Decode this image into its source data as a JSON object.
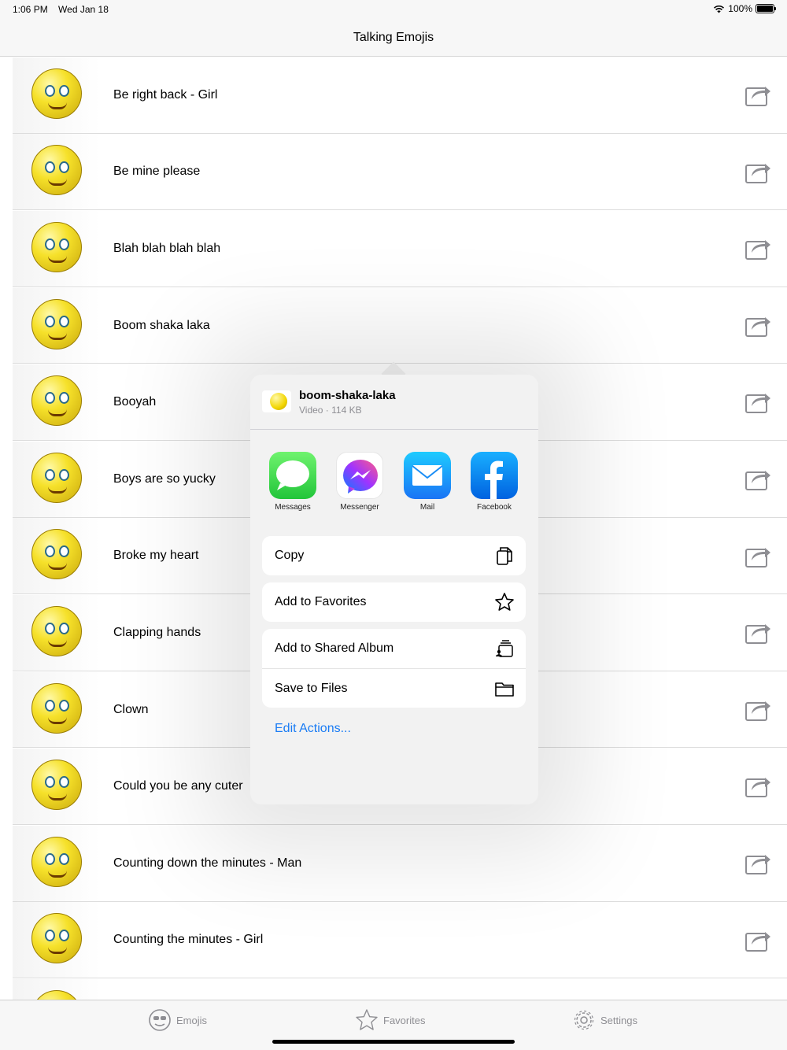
{
  "status_bar": {
    "time": "1:06 PM",
    "date": "Wed Jan 18",
    "battery": "100%",
    "battery_level": 1.0
  },
  "nav": {
    "title": "Talking Emojis"
  },
  "rows": [
    {
      "label": "Be right back - Girl"
    },
    {
      "label": "Be mine please"
    },
    {
      "label": "Blah blah blah blah"
    },
    {
      "label": "Boom shaka laka"
    },
    {
      "label": "Booyah"
    },
    {
      "label": "Boys are so yucky"
    },
    {
      "label": "Broke my heart"
    },
    {
      "label": "Clapping hands"
    },
    {
      "label": "Clown"
    },
    {
      "label": "Could you be any cuter"
    },
    {
      "label": "Counting down the minutes - Man"
    },
    {
      "label": "Counting the minutes - Girl"
    }
  ],
  "share_sheet": {
    "file_name": "boom-shaka-laka",
    "file_info": "Video · 114 KB",
    "apps": [
      {
        "label": "Messages",
        "icon": "messages-icon"
      },
      {
        "label": "Messenger",
        "icon": "messenger-icon"
      },
      {
        "label": "Mail",
        "icon": "mail-icon"
      },
      {
        "label": "Facebook",
        "icon": "facebook-icon"
      }
    ],
    "actions": {
      "copy": "Copy",
      "add_to_favorites": "Add to Favorites",
      "add_to_shared_album": "Add to Shared Album",
      "save_to_files": "Save to Files"
    },
    "edit_actions": "Edit Actions..."
  },
  "tabs": [
    {
      "label": "Emojis",
      "icon": "emoji-face-icon"
    },
    {
      "label": "Favorites",
      "icon": "star-icon"
    },
    {
      "label": "Settings",
      "icon": "gear-icon"
    }
  ],
  "colors": {
    "accent": "#1a7cf4",
    "tab_inactive": "#8e8e93",
    "emoji_yellow": "#f6e12a"
  }
}
